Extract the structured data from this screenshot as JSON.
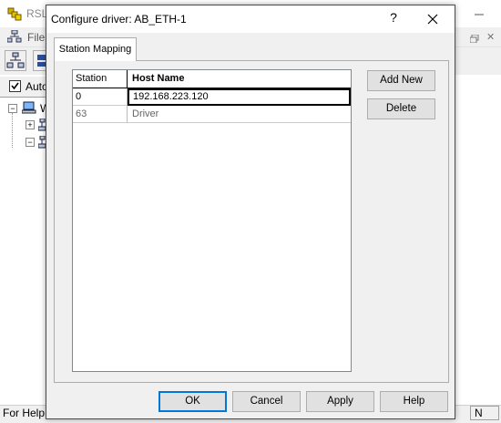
{
  "background_app": {
    "title": "RSLi",
    "menu_file": "File",
    "auto_label": "Auto",
    "tree_root_label": "W",
    "status_text": "For Help,",
    "status_n": "N"
  },
  "dialog": {
    "title": "Configure driver: AB_ETH-1",
    "help_label": "?",
    "tab_label": "Station Mapping",
    "grid": {
      "columns": [
        "Station",
        "Host Name"
      ],
      "rows": [
        {
          "station": "0",
          "host": "192.168.223.120"
        },
        {
          "station": "63",
          "host": "Driver"
        }
      ]
    },
    "buttons": {
      "add_new": "Add New",
      "delete": "Delete",
      "ok": "OK",
      "cancel": "Cancel",
      "apply": "Apply",
      "help": "Help"
    }
  },
  "colors": {
    "dialog_bg": "#f0f0f0",
    "default_button_border": "#0078d7"
  }
}
